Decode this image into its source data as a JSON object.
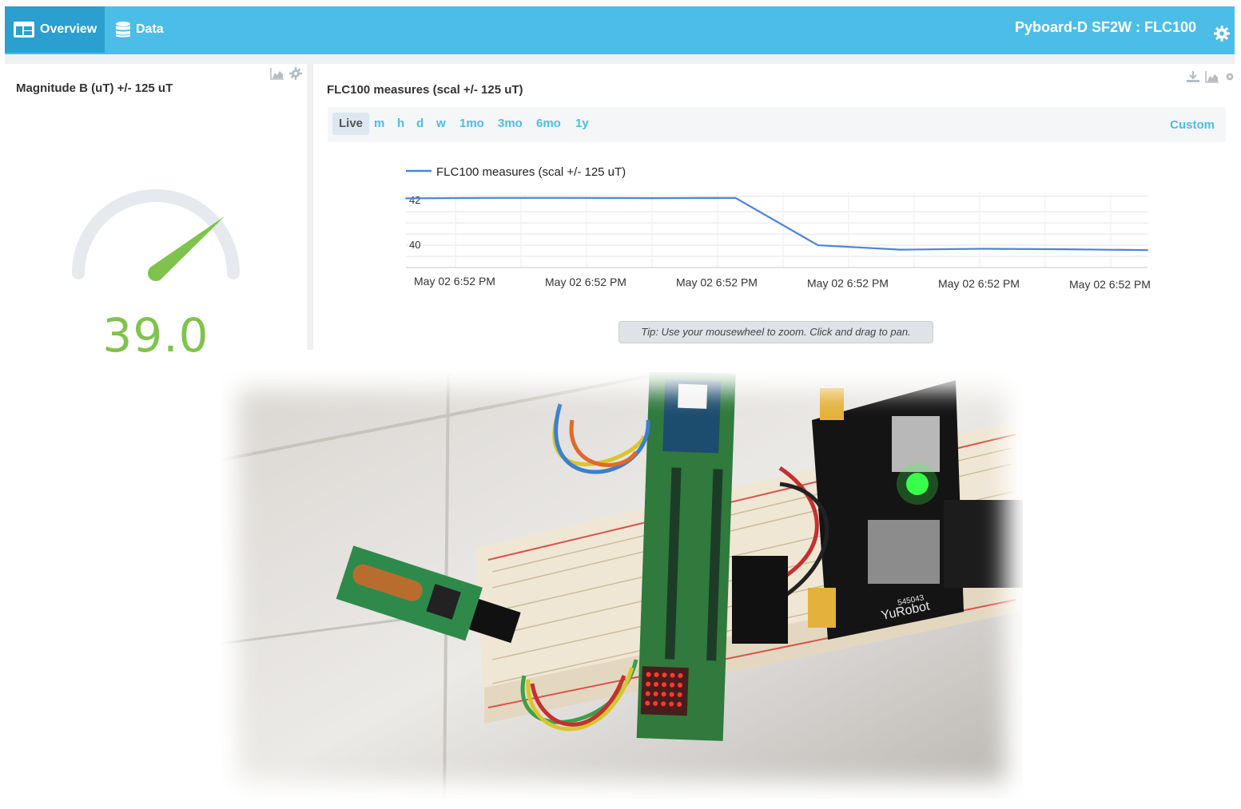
{
  "nav": {
    "tabs": [
      {
        "label": "Overview",
        "icon": "dashboard-icon",
        "active": true
      },
      {
        "label": "Data",
        "icon": "database-icon",
        "active": false
      }
    ],
    "device_title": "Pyboard-D SF2W : FLC100"
  },
  "gauge": {
    "title": "Magnitude B (uT) +/- 125 uT",
    "value": "39.0",
    "level_fraction": 0.78,
    "color": "#7fc34c"
  },
  "chart_panel": {
    "title": "FLC100 measures (scal +/- 125 uT)",
    "ranges": [
      "Live",
      "m",
      "h",
      "d",
      "w",
      "1mo",
      "3mo",
      "6mo",
      "1y"
    ],
    "active_range": "Live",
    "custom_label": "Custom",
    "tip": "Tip: Use your mousewheel to zoom. Click and drag to pan."
  },
  "chart_data": {
    "type": "line",
    "title": "",
    "legend": [
      "FLC100 measures (scal +/- 125 uT)"
    ],
    "legend_position": "top-left",
    "xlabel": "",
    "ylabel": "",
    "x_tick_labels": [
      "May 02 6:52 PM",
      "May 02 6:52 PM",
      "May 02 6:52 PM",
      "May 02 6:52 PM",
      "May 02 6:52 PM",
      "May 02 6:52 PM"
    ],
    "y_tick_labels": [
      "42",
      "40"
    ],
    "ylim": [
      39,
      42.4
    ],
    "grid": true,
    "color": "#4a86d8",
    "series": [
      {
        "name": "FLC100 measures (scal +/- 125 uT)",
        "x": [
          0,
          1,
          2,
          3,
          4,
          5,
          6,
          7,
          8,
          9
        ],
        "values": [
          42.1,
          42.12,
          42.12,
          42.11,
          42.12,
          40.0,
          39.8,
          39.84,
          39.82,
          39.78
        ]
      }
    ]
  },
  "photo": {
    "board_label": "YuRobot",
    "board_code": "545043"
  },
  "colors": {
    "header": "#4cbde6",
    "header_active": "#2a9fd0",
    "accent": "#4cbde6",
    "gauge_green": "#7fc34c",
    "line_blue": "#4a86d8"
  }
}
